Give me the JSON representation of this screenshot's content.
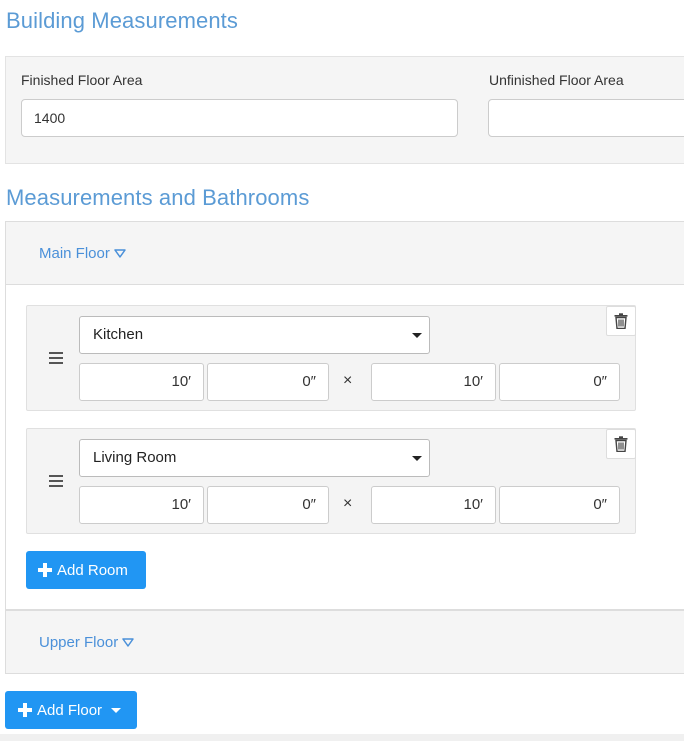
{
  "sections": {
    "building_title": "Building Measurements",
    "measurements_title": "Measurements and Bathrooms"
  },
  "building": {
    "finished_label": "Finished Floor Area",
    "finished_value": "1400",
    "unfinished_label": "Unfinished Floor Area",
    "unfinished_value": ""
  },
  "floors": [
    {
      "label": "Main Floor",
      "rooms": [
        {
          "type": "Kitchen",
          "len_ft": "10′",
          "len_in": "0″",
          "wid_ft": "10′",
          "wid_in": "0″"
        },
        {
          "type": "Living Room",
          "len_ft": "10′",
          "len_in": "0″",
          "wid_ft": "10′",
          "wid_in": "0″"
        }
      ]
    },
    {
      "label": "Upper Floor"
    }
  ],
  "symbols": {
    "times": "×"
  },
  "buttons": {
    "add_room": "Add Room",
    "add_floor": "Add Floor"
  },
  "colors": {
    "heading": "#5b9bd5",
    "link": "#4a90d9",
    "primary_button": "#2196f3"
  },
  "icons": {
    "drag": "drag-handle-icon",
    "delete": "trash-icon",
    "expand": "triangle-down-icon",
    "add": "plus-icon"
  }
}
